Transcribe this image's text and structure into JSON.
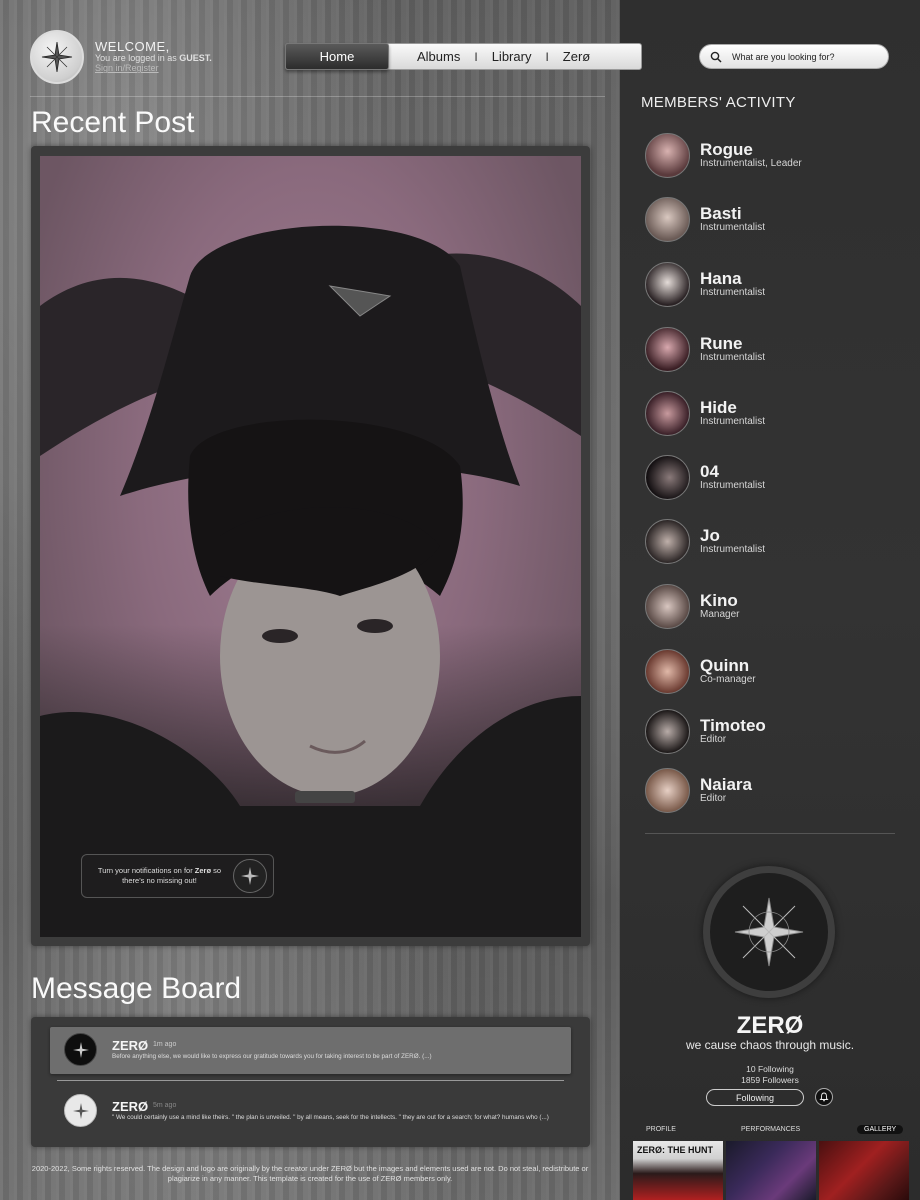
{
  "header": {
    "welcome_title": "WELCOME,",
    "logged_in_prefix": "You are logged in as ",
    "user": "GUEST.",
    "sign_link": "Sign in/Register"
  },
  "nav": {
    "items": [
      "Home",
      "Albums",
      "Library",
      "Zerø"
    ],
    "separator": "I"
  },
  "search": {
    "placeholder": "What are you looking for?"
  },
  "recent_post": {
    "title": "Recent Post",
    "notification_prefix": "Turn your notifications on for ",
    "notification_brand": "Zerø",
    "notification_suffix": " so there's no missing out!"
  },
  "message_board": {
    "title": "Message Board",
    "messages": [
      {
        "author": "ZERØ",
        "time": "1m ago",
        "text": "Before anything else, we would like to express our gratitude towards you for taking interest to be part of ZERØ. (...)"
      },
      {
        "author": "ZERØ",
        "time": "5m ago",
        "text": "\" We could certainly use a mind like theirs. \" the plan is unveiled. \" by all means, seek for the intellects. \" they are out for a search; for what? humans who (...)"
      }
    ]
  },
  "footer": {
    "text": "2020-2022, Some rights reserved. The design and logo are originally by the creator under ZERØ but the images and elements  used are not. Do not steal, redistribute or plagiarize in any manner. This template is created for the use of ZERØ members only."
  },
  "sidebar": {
    "title": "MEMBERS' ACTIVITY",
    "members": [
      {
        "name": "Rogue",
        "role": "Instrumentalist, Leader"
      },
      {
        "name": "Basti",
        "role": "Instrumentalist"
      },
      {
        "name": "Hana",
        "role": "Instrumentalist"
      },
      {
        "name": "Rune",
        "role": "Instrumentalist"
      },
      {
        "name": "Hide",
        "role": "Instrumentalist"
      },
      {
        "name": "04",
        "role": "Instrumentalist"
      },
      {
        "name": "Jo",
        "role": "Instrumentalist"
      },
      {
        "name": "Kino",
        "role": "Manager"
      },
      {
        "name": "Quinn",
        "role": "Co-manager"
      },
      {
        "name": "Timoteo",
        "role": "Editor"
      },
      {
        "name": "Naiara",
        "role": "Editor"
      }
    ]
  },
  "profile": {
    "name": "ZERØ",
    "tagline": "we cause chaos through music.",
    "following": "10 Following",
    "followers": "1859 Followers",
    "follow_button": "Following",
    "tabs": [
      "PROFILE",
      "PERFORMANCES",
      "GALLERY"
    ],
    "active_tab": "GALLERY",
    "thumb_caption": "ZERØ: THE HUNT"
  },
  "colors": {
    "photo_background": "#a17e93",
    "sidebar_background": "#2f2f2f",
    "nav_active": "#3a3a3a"
  }
}
